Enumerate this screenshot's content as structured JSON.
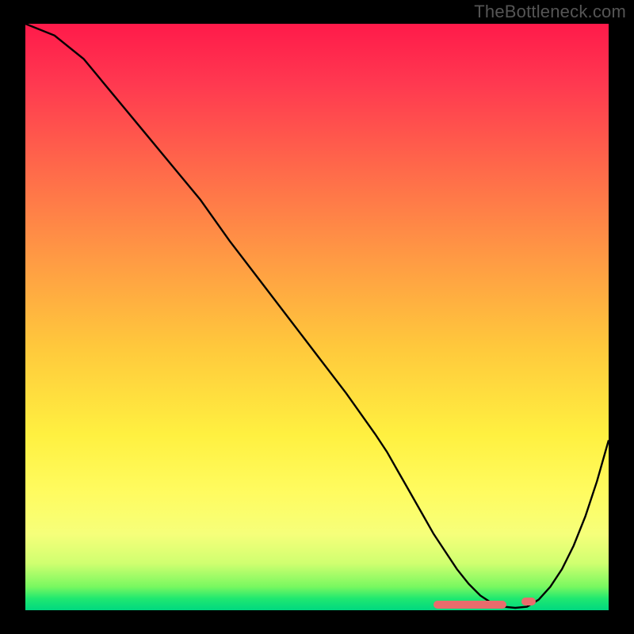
{
  "watermark": "TheBottleneck.com",
  "chart_data": {
    "type": "line",
    "title": "",
    "xlabel": "",
    "ylabel": "",
    "xlim": [
      0,
      100
    ],
    "ylim": [
      0,
      100
    ],
    "series": [
      {
        "name": "curve",
        "x": [
          0,
          5,
          10,
          15,
          20,
          25,
          30,
          35,
          40,
          45,
          50,
          55,
          60,
          62,
          64,
          66,
          68,
          70,
          72,
          74,
          76,
          78,
          80,
          82,
          84,
          86,
          88,
          90,
          92,
          94,
          96,
          98,
          100
        ],
        "y": [
          100,
          98,
          94,
          88,
          82,
          76,
          70,
          63,
          56.5,
          50,
          43.5,
          37,
          30,
          27,
          23.5,
          20,
          16.5,
          13,
          10,
          7,
          4.5,
          2.5,
          1.2,
          0.6,
          0.4,
          0.6,
          1.8,
          4,
          7,
          11,
          16,
          22,
          29
        ]
      }
    ],
    "highlight_dashes": {
      "left": {
        "x_start": 70,
        "x_end": 82.5,
        "y": 0.9
      },
      "right": {
        "x_start": 85,
        "x_end": 87.5,
        "y": 1.5
      }
    },
    "colors": {
      "curve": "#000000",
      "dash": "#e96c6c",
      "gradient_top": "#ff1a4a",
      "gradient_mid": "#fff040",
      "gradient_bottom": "#00d880"
    }
  }
}
